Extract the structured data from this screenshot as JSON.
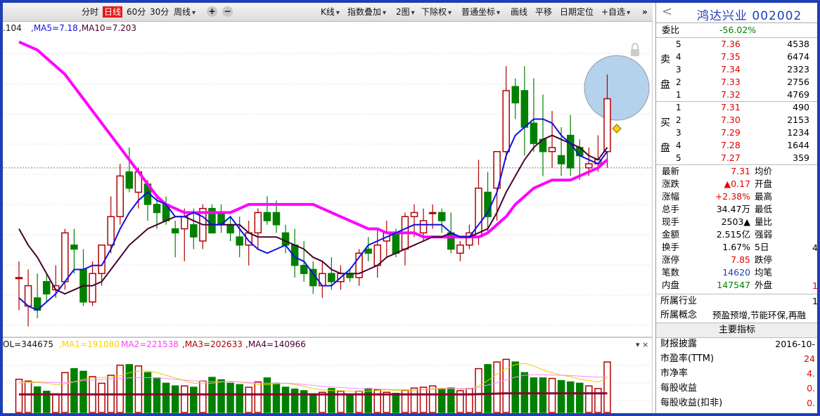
{
  "toolbar": {
    "period_tabs": [
      "分时",
      "日线",
      "60分",
      "30分"
    ],
    "active_tab": "日线",
    "week_label": "周线",
    "plus_label": "+",
    "minus_label": "−",
    "kline_label": "K线",
    "overlay_label": "指数叠加",
    "two_chart_label": "2图",
    "exright_label": "下除权",
    "coord_label": "普通坐标",
    "draw_label": "画线",
    "pan_label": "平移",
    "date_locate_label": "日期定位",
    "watchlist_label": "+自选",
    "next_label": "»"
  },
  "legend": {
    "ma_first": ".104",
    "ma5": ",MA5=7.18",
    "ma10": ",MA10=7.203",
    "vol": "OL=344675",
    "vol_ma1": ",MA1=191080",
    "vol_ma2": "MA2=221538",
    "vol_ma3": ",MA3=202633",
    "vol_ma4": ",MA4=140966"
  },
  "colors": {
    "up": "#b00000",
    "down": "#008000",
    "ma_blue": "#1010e0",
    "ma_dark": "#4a0030",
    "ma_magenta": "#ff00ff",
    "highlight_circle": "#a9cbea",
    "panel_red": "#e00000",
    "panel_green": "#008000"
  },
  "chart_data": {
    "type": "candlestick",
    "y_range": [
      6.73,
      7.47
    ],
    "ref_line": 7.14,
    "candles": [
      {
        "o": 6.87,
        "h": 6.91,
        "l": 6.79,
        "c": 6.87,
        "v": 1250
      },
      {
        "o": 6.8,
        "h": 6.89,
        "l": 6.75,
        "c": 6.85,
        "v": 1180
      },
      {
        "o": 6.82,
        "h": 6.88,
        "l": 6.77,
        "c": 6.79,
        "v": 960
      },
      {
        "o": 6.86,
        "h": 6.88,
        "l": 6.81,
        "c": 6.83,
        "v": 800
      },
      {
        "o": 6.84,
        "h": 6.9,
        "l": 6.82,
        "c": 6.85,
        "v": 700
      },
      {
        "o": 6.86,
        "h": 6.99,
        "l": 6.84,
        "c": 6.98,
        "v": 1500
      },
      {
        "o": 6.95,
        "h": 6.99,
        "l": 6.88,
        "c": 6.94,
        "v": 1650
      },
      {
        "o": 6.89,
        "h": 6.94,
        "l": 6.8,
        "c": 6.81,
        "v": 1550
      },
      {
        "o": 6.81,
        "h": 6.91,
        "l": 6.8,
        "c": 6.88,
        "v": 1350
      },
      {
        "o": 6.88,
        "h": 6.95,
        "l": 6.85,
        "c": 6.95,
        "v": 1100
      },
      {
        "o": 6.95,
        "h": 7.07,
        "l": 6.93,
        "c": 7.02,
        "v": 1400
      },
      {
        "o": 7.02,
        "h": 7.15,
        "l": 7.0,
        "c": 7.12,
        "v": 1780
      },
      {
        "o": 7.13,
        "h": 7.19,
        "l": 7.08,
        "c": 7.09,
        "v": 1800
      },
      {
        "o": 7.08,
        "h": 7.14,
        "l": 7.04,
        "c": 7.13,
        "v": 1750
      },
      {
        "o": 7.1,
        "h": 7.11,
        "l": 7.01,
        "c": 7.05,
        "v": 1500
      },
      {
        "o": 7.05,
        "h": 7.07,
        "l": 6.99,
        "c": 7.03,
        "v": 1300
      },
      {
        "o": 7.05,
        "h": 7.07,
        "l": 7.0,
        "c": 7.01,
        "v": 1100
      },
      {
        "o": 6.99,
        "h": 7.01,
        "l": 6.92,
        "c": 6.98,
        "v": 1000
      },
      {
        "o": 6.99,
        "h": 7.04,
        "l": 6.91,
        "c": 7.02,
        "v": 1000
      },
      {
        "o": 7.0,
        "h": 7.04,
        "l": 6.94,
        "c": 6.97,
        "v": 950
      },
      {
        "o": 6.96,
        "h": 7.05,
        "l": 6.94,
        "c": 7.04,
        "v": 1180
      },
      {
        "o": 7.04,
        "h": 7.05,
        "l": 6.98,
        "c": 6.98,
        "v": 1320
      },
      {
        "o": 7.03,
        "h": 7.05,
        "l": 6.98,
        "c": 7.0,
        "v": 1230
      },
      {
        "o": 7.0,
        "h": 7.02,
        "l": 6.96,
        "c": 6.98,
        "v": 1100
      },
      {
        "o": 6.97,
        "h": 7.02,
        "l": 6.92,
        "c": 6.95,
        "v": 1050
      },
      {
        "o": 6.95,
        "h": 7.01,
        "l": 6.9,
        "c": 6.98,
        "v": 950
      },
      {
        "o": 6.98,
        "h": 7.04,
        "l": 6.94,
        "c": 7.03,
        "v": 1150
      },
      {
        "o": 7.03,
        "h": 7.07,
        "l": 7.0,
        "c": 7.01,
        "v": 1300
      },
      {
        "o": 7.03,
        "h": 7.06,
        "l": 6.98,
        "c": 7.0,
        "v": 1100
      },
      {
        "o": 6.98,
        "h": 7.0,
        "l": 6.93,
        "c": 6.95,
        "v": 950
      },
      {
        "o": 6.95,
        "h": 6.99,
        "l": 6.87,
        "c": 6.9,
        "v": 880
      },
      {
        "o": 6.9,
        "h": 6.96,
        "l": 6.86,
        "c": 6.88,
        "v": 820
      },
      {
        "o": 6.89,
        "h": 6.91,
        "l": 6.83,
        "c": 6.85,
        "v": 700
      },
      {
        "o": 6.85,
        "h": 6.91,
        "l": 6.82,
        "c": 6.88,
        "v": 760
      },
      {
        "o": 6.88,
        "h": 6.92,
        "l": 6.84,
        "c": 6.86,
        "v": 900
      },
      {
        "o": 6.86,
        "h": 6.9,
        "l": 6.84,
        "c": 6.88,
        "v": 800
      },
      {
        "o": 6.88,
        "h": 6.89,
        "l": 6.86,
        "c": 6.87,
        "v": 680
      },
      {
        "o": 6.87,
        "h": 6.94,
        "l": 6.85,
        "c": 6.93,
        "v": 800
      },
      {
        "o": 6.94,
        "h": 6.97,
        "l": 6.91,
        "c": 6.93,
        "v": 900
      },
      {
        "o": 6.9,
        "h": 6.99,
        "l": 6.87,
        "c": 6.95,
        "v": 850
      },
      {
        "o": 6.96,
        "h": 7.01,
        "l": 6.92,
        "c": 6.98,
        "v": 760
      },
      {
        "o": 6.98,
        "h": 6.99,
        "l": 6.92,
        "c": 6.93,
        "v": 720
      },
      {
        "o": 6.94,
        "h": 7.03,
        "l": 6.9,
        "c": 7.02,
        "v": 830
      },
      {
        "o": 7.02,
        "h": 7.05,
        "l": 6.97,
        "c": 7.03,
        "v": 920
      },
      {
        "o": 6.98,
        "h": 7.04,
        "l": 6.96,
        "c": 7.01,
        "v": 950
      },
      {
        "o": 7.03,
        "h": 7.05,
        "l": 6.99,
        "c": 7.03,
        "v": 1000
      },
      {
        "o": 7.03,
        "h": 7.04,
        "l": 6.98,
        "c": 7.01,
        "v": 880
      },
      {
        "o": 6.98,
        "h": 7.03,
        "l": 6.93,
        "c": 6.94,
        "v": 920
      },
      {
        "o": 6.93,
        "h": 6.96,
        "l": 6.91,
        "c": 6.95,
        "v": 820
      },
      {
        "o": 6.95,
        "h": 7.0,
        "l": 6.94,
        "c": 6.98,
        "v": 900
      },
      {
        "o": 6.97,
        "h": 7.16,
        "l": 6.95,
        "c": 7.09,
        "v": 1650
      },
      {
        "o": 7.08,
        "h": 7.13,
        "l": 6.98,
        "c": 7.02,
        "v": 1800
      },
      {
        "o": 7.09,
        "h": 7.18,
        "l": 7.01,
        "c": 7.18,
        "v": 1900
      },
      {
        "o": 7.18,
        "h": 7.39,
        "l": 7.16,
        "c": 7.33,
        "v": 2000
      },
      {
        "o": 7.34,
        "h": 7.36,
        "l": 7.26,
        "c": 7.3,
        "v": 1900
      },
      {
        "o": 7.33,
        "h": 7.39,
        "l": 7.17,
        "c": 7.24,
        "v": 1500
      },
      {
        "o": 7.25,
        "h": 7.36,
        "l": 7.18,
        "c": 7.2,
        "v": 1300
      },
      {
        "o": 7.21,
        "h": 7.32,
        "l": 7.12,
        "c": 7.18,
        "v": 1300
      },
      {
        "o": 7.18,
        "h": 7.28,
        "l": 7.14,
        "c": 7.19,
        "v": 1280
      },
      {
        "o": 7.17,
        "h": 7.24,
        "l": 7.12,
        "c": 7.15,
        "v": 1200
      },
      {
        "o": 7.22,
        "h": 7.27,
        "l": 7.12,
        "c": 7.14,
        "v": 1150
      },
      {
        "o": 7.19,
        "h": 7.21,
        "l": 7.11,
        "c": 7.17,
        "v": 1100
      },
      {
        "o": 7.14,
        "h": 7.19,
        "l": 7.12,
        "c": 7.15,
        "v": 1000
      },
      {
        "o": 7.15,
        "h": 7.22,
        "l": 7.13,
        "c": 7.16,
        "v": 900
      },
      {
        "o": 7.18,
        "h": 7.37,
        "l": 7.14,
        "c": 7.31,
        "v": 1900
      }
    ],
    "ma_blue": [
      6.82,
      6.8,
      6.79,
      6.81,
      6.83,
      6.86,
      6.89,
      6.89,
      6.9,
      6.9,
      6.94,
      6.99,
      7.03,
      7.06,
      7.08,
      7.06,
      7.05,
      7.02,
      7.02,
      7.03,
      7.02,
      7.0,
      7.0,
      7.02,
      6.99,
      6.96,
      6.94,
      6.93,
      6.94,
      6.95,
      6.92,
      6.91,
      6.88,
      6.85,
      6.85,
      6.87,
      6.89,
      6.92,
      6.95,
      6.96,
      6.97,
      6.98,
      6.99,
      7.0,
      7.0,
      7.0,
      7.0,
      6.98,
      6.97,
      6.97,
      7.0,
      7.03,
      7.08,
      7.17,
      7.22,
      7.24,
      7.26,
      7.26,
      7.25,
      7.22,
      7.2,
      7.17,
      7.16,
      7.15,
      7.18
    ],
    "ma_dark": [
      6.99,
      6.95,
      6.92,
      6.88,
      6.84,
      6.83,
      6.84,
      6.85,
      6.85,
      6.86,
      6.89,
      6.92,
      6.95,
      6.97,
      6.99,
      7.0,
      7.01,
      7.02,
      7.02,
      7.01,
      7.0,
      7.0,
      7.0,
      7.0,
      7.0,
      6.98,
      6.97,
      6.97,
      6.97,
      6.96,
      6.95,
      6.94,
      6.92,
      6.91,
      6.89,
      6.88,
      6.88,
      6.88,
      6.89,
      6.9,
      6.92,
      6.93,
      6.94,
      6.95,
      6.96,
      6.97,
      6.97,
      6.98,
      6.97,
      6.97,
      6.98,
      6.99,
      7.03,
      7.08,
      7.12,
      7.16,
      7.19,
      7.21,
      7.22,
      7.21,
      7.2,
      7.19,
      7.17,
      7.16,
      7.19
    ],
    "ma_magenta": [
      7.45,
      7.44,
      7.43,
      7.41,
      7.39,
      7.37,
      7.34,
      7.31,
      7.28,
      7.25,
      7.22,
      7.19,
      7.16,
      7.13,
      7.1,
      7.07,
      7.05,
      7.04,
      7.03,
      7.03,
      7.03,
      7.03,
      7.03,
      7.03,
      7.04,
      7.05,
      7.05,
      7.05,
      7.05,
      7.05,
      7.05,
      7.05,
      7.05,
      7.04,
      7.03,
      7.02,
      7.01,
      7.0,
      6.99,
      6.99,
      6.98,
      6.98,
      6.98,
      6.98,
      6.97,
      6.97,
      6.97,
      6.97,
      6.97,
      6.97,
      6.97,
      6.98,
      7.0,
      7.02,
      7.05,
      7.07,
      7.09,
      7.1,
      7.11,
      7.11,
      7.11,
      7.12,
      7.13,
      7.14,
      7.16
    ],
    "vol_range": [
      0,
      2300
    ],
    "vol_ma_dark": [
      680,
      680,
      680,
      680,
      680,
      680,
      680,
      680,
      680,
      680,
      680,
      680,
      680,
      680,
      680,
      680,
      680,
      680,
      680,
      680,
      680,
      680,
      680,
      680,
      680,
      680,
      680,
      680,
      680,
      680,
      680,
      680,
      680,
      680,
      680,
      680,
      680,
      680,
      680,
      680,
      680,
      680,
      680,
      680,
      680,
      680,
      680,
      680,
      680,
      680,
      690,
      700,
      710,
      720,
      720,
      720,
      720,
      720,
      720,
      720,
      720,
      720,
      720,
      720,
      720
    ],
    "vol_ma_yellow": [
      1100,
      1120,
      1130,
      1100,
      1050,
      1080,
      1150,
      1250,
      1300,
      1320,
      1330,
      1380,
      1500,
      1560,
      1560,
      1500,
      1400,
      1300,
      1200,
      1100,
      1090,
      1100,
      1150,
      1180,
      1150,
      1100,
      1050,
      1050,
      1080,
      1100,
      1050,
      980,
      900,
      850,
      830,
      820,
      800,
      790,
      800,
      830,
      850,
      830,
      820,
      840,
      870,
      900,
      920,
      900,
      880,
      880,
      1000,
      1200,
      1450,
      1650,
      1800,
      1850,
      1750,
      1600,
      1500,
      1400,
      1350,
      1250,
      1200,
      1150,
      1300
    ],
    "vol_ma_pink": [
      1150,
      1150,
      1150,
      1140,
      1130,
      1130,
      1150,
      1200,
      1220,
      1240,
      1260,
      1280,
      1300,
      1310,
      1310,
      1300,
      1280,
      1250,
      1220,
      1190,
      1170,
      1160,
      1160,
      1160,
      1150,
      1130,
      1110,
      1100,
      1100,
      1100,
      1080,
      1050,
      1020,
      990,
      960,
      940,
      920,
      900,
      890,
      880,
      870,
      860,
      860,
      860,
      870,
      880,
      890,
      900,
      900,
      900,
      950,
      1030,
      1120,
      1230,
      1330,
      1400,
      1420,
      1420,
      1410,
      1400,
      1390,
      1370,
      1350,
      1330,
      1350
    ]
  },
  "panel": {
    "back": "<",
    "title": "鸿达兴业 002002",
    "weibi_label": "委比",
    "weibi_value": "-56.02%",
    "sell_label_1": "卖",
    "sell_label_2": "盘",
    "buy_label_1": "买",
    "buy_label_2": "盘",
    "asks": [
      {
        "level": "5",
        "price": "7.36",
        "vol": "4538"
      },
      {
        "level": "4",
        "price": "7.35",
        "vol": "6474"
      },
      {
        "level": "3",
        "price": "7.34",
        "vol": "2323"
      },
      {
        "level": "2",
        "price": "7.33",
        "vol": "2756"
      },
      {
        "level": "1",
        "price": "7.32",
        "vol": "4769"
      }
    ],
    "bids": [
      {
        "level": "1",
        "price": "7.31",
        "vol": "490"
      },
      {
        "level": "2",
        "price": "7.30",
        "vol": "2153"
      },
      {
        "level": "3",
        "price": "7.29",
        "vol": "1234"
      },
      {
        "level": "4",
        "price": "7.28",
        "vol": "1644"
      },
      {
        "level": "5",
        "price": "7.27",
        "vol": "359"
      }
    ],
    "stats": [
      {
        "label": "最新",
        "value": "7.31",
        "cls": "red",
        "label2": "均价"
      },
      {
        "label": "涨跌",
        "value": "▲0.17",
        "cls": "red",
        "label2": "开盘"
      },
      {
        "label": "涨幅",
        "value": "+2.38%",
        "cls": "red",
        "label2": "最高"
      },
      {
        "label": "总手",
        "value": "34.47万",
        "cls": "",
        "label2": "最低"
      },
      {
        "label": "现手",
        "value": "2503▲",
        "cls": "",
        "label2": "量比"
      },
      {
        "label": "金额",
        "value": "2.515亿",
        "cls": "",
        "label2": "强弱"
      },
      {
        "label": "换手",
        "value": "1.67%",
        "cls": "",
        "label2": "5日"
      },
      {
        "label": "涨停",
        "value": "7.85",
        "cls": "red",
        "label2": "跌停"
      },
      {
        "label": "笔数",
        "value": "14620",
        "cls": "blue",
        "label2": "均笔"
      },
      {
        "label": "内盘",
        "value": "147547",
        "cls": "green",
        "label2": "外盘"
      }
    ],
    "wuri_tail": "4",
    "waipan_tail": "1",
    "industry_label": "所属行业",
    "industry_tail": "1",
    "concept_label": "所属概念",
    "concept_value": "预盈预增,节能环保,再融",
    "main_header": "主要指标",
    "metrics": [
      {
        "label": "财报披露",
        "value": "2016-10-",
        "cls": ""
      },
      {
        "label": "市盈率(TTM)",
        "value": "24",
        "cls": "red"
      },
      {
        "label": "市净率",
        "value": "4.",
        "cls": "red"
      },
      {
        "label": "每股收益",
        "value": "0.",
        "cls": "red"
      },
      {
        "label": "每股收益(扣非)",
        "value": "0.",
        "cls": "red"
      }
    ]
  }
}
